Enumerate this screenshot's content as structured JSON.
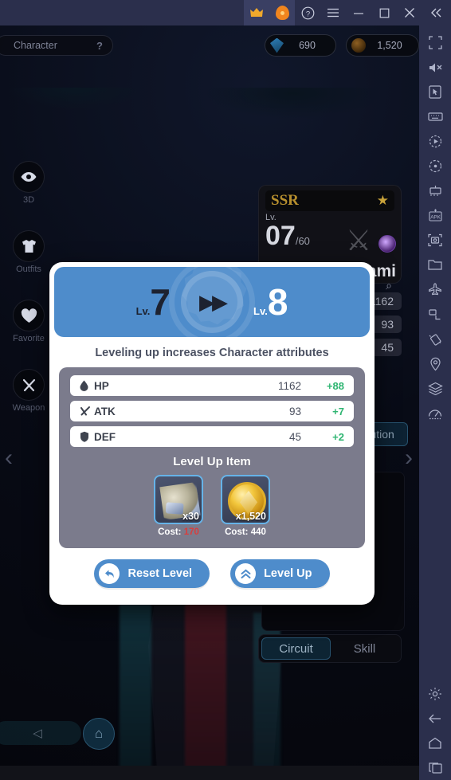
{
  "window": {
    "buttons": [
      {
        "name": "crown-icon",
        "glyph": "♛"
      },
      {
        "name": "flame-icon",
        "glyph": ""
      },
      {
        "name": "help-icon",
        "glyph": "?"
      },
      {
        "name": "menu-icon",
        "glyph": "☰"
      },
      {
        "name": "minimize-icon",
        "glyph": "‒"
      },
      {
        "name": "maximize-icon",
        "glyph": "□"
      },
      {
        "name": "close-icon",
        "glyph": "✕"
      },
      {
        "name": "collapse-icon",
        "glyph": "«"
      }
    ]
  },
  "sidebar": {
    "items": [
      {
        "name": "fullscreen-icon"
      },
      {
        "name": "mute-icon"
      },
      {
        "name": "cursor-icon"
      },
      {
        "name": "keyboard-icon"
      },
      {
        "name": "record-icon"
      },
      {
        "name": "macro-icon"
      },
      {
        "name": "multi-instance-icon"
      },
      {
        "name": "apk-install-icon"
      },
      {
        "name": "screenshot-icon"
      },
      {
        "name": "folder-icon"
      },
      {
        "name": "airplane-icon"
      },
      {
        "name": "rotate-icon"
      },
      {
        "name": "shake-icon"
      },
      {
        "name": "location-icon"
      },
      {
        "name": "layers-icon"
      },
      {
        "name": "performance-icon"
      },
      {
        "name": "settings-icon"
      },
      {
        "name": "back-icon"
      },
      {
        "name": "home-icon"
      },
      {
        "name": "recents-icon"
      }
    ]
  },
  "hud": {
    "character_label": "Character",
    "help_glyph": "?",
    "currencies": [
      {
        "name": "gem-currency",
        "value": "690"
      },
      {
        "name": "gold-currency",
        "value": "1,520"
      }
    ]
  },
  "rail": {
    "items": [
      {
        "label": "3D",
        "icon": "eye-icon",
        "glyph": "◉"
      },
      {
        "label": "Outfits",
        "icon": "shirt-icon",
        "glyph": "■"
      },
      {
        "label": "Favorite",
        "icon": "heart-icon",
        "glyph": "♥"
      },
      {
        "label": "Weapon",
        "icon": "sword-icon",
        "glyph": "⚔"
      }
    ]
  },
  "nav": {
    "prev_glyph": "‹",
    "next_glyph": "›"
  },
  "character_card": {
    "rarity": "SSR",
    "star_glyph": "★",
    "level_label": "Lv.",
    "level": "07",
    "level_max": "/60",
    "name": "Hasami",
    "emblem_glyph": "⚔"
  },
  "side_stats": {
    "search_glyph": "⌕",
    "values": [
      "1162",
      "93",
      "45"
    ],
    "ghost_number": "6",
    "evolution_label": "Evolution",
    "tabs": [
      {
        "label": "Circuit",
        "active": true
      },
      {
        "label": "Skill",
        "active": false
      }
    ]
  },
  "bottom_nav": {
    "back_glyph": "◁",
    "home_glyph": "⌂"
  },
  "dialog": {
    "level_label_from": "Lv.",
    "level_from": "7",
    "level_label_to": "Lv.",
    "level_to": "8",
    "arrow_glyph": "▶▶",
    "subtitle": "Leveling up increases Character attributes",
    "stats": [
      {
        "icon": "hp-drop-icon",
        "glyph": "◆",
        "name": "HP",
        "value": "1162",
        "delta": "+88"
      },
      {
        "icon": "atk-sword-icon",
        "glyph": "⚔",
        "name": "ATK",
        "value": "93",
        "delta": "+7"
      },
      {
        "icon": "def-shield-icon",
        "glyph": "⛨",
        "name": "DEF",
        "value": "45",
        "delta": "+2"
      }
    ],
    "items_title": "Level Up Item",
    "items": [
      {
        "name": "level-up-scroll-item",
        "qty": "x30",
        "cost_label": "Cost:",
        "cost_value": "170",
        "insufficient": true
      },
      {
        "name": "gold-coin-item",
        "qty": "x1,520",
        "cost_label": "Cost:",
        "cost_value": "440",
        "insufficient": false
      }
    ],
    "buttons": [
      {
        "name": "reset-level-button",
        "label": "Reset Level",
        "glyph": "↺"
      },
      {
        "name": "level-up-button",
        "label": "Level Up",
        "glyph": "∧"
      }
    ]
  }
}
